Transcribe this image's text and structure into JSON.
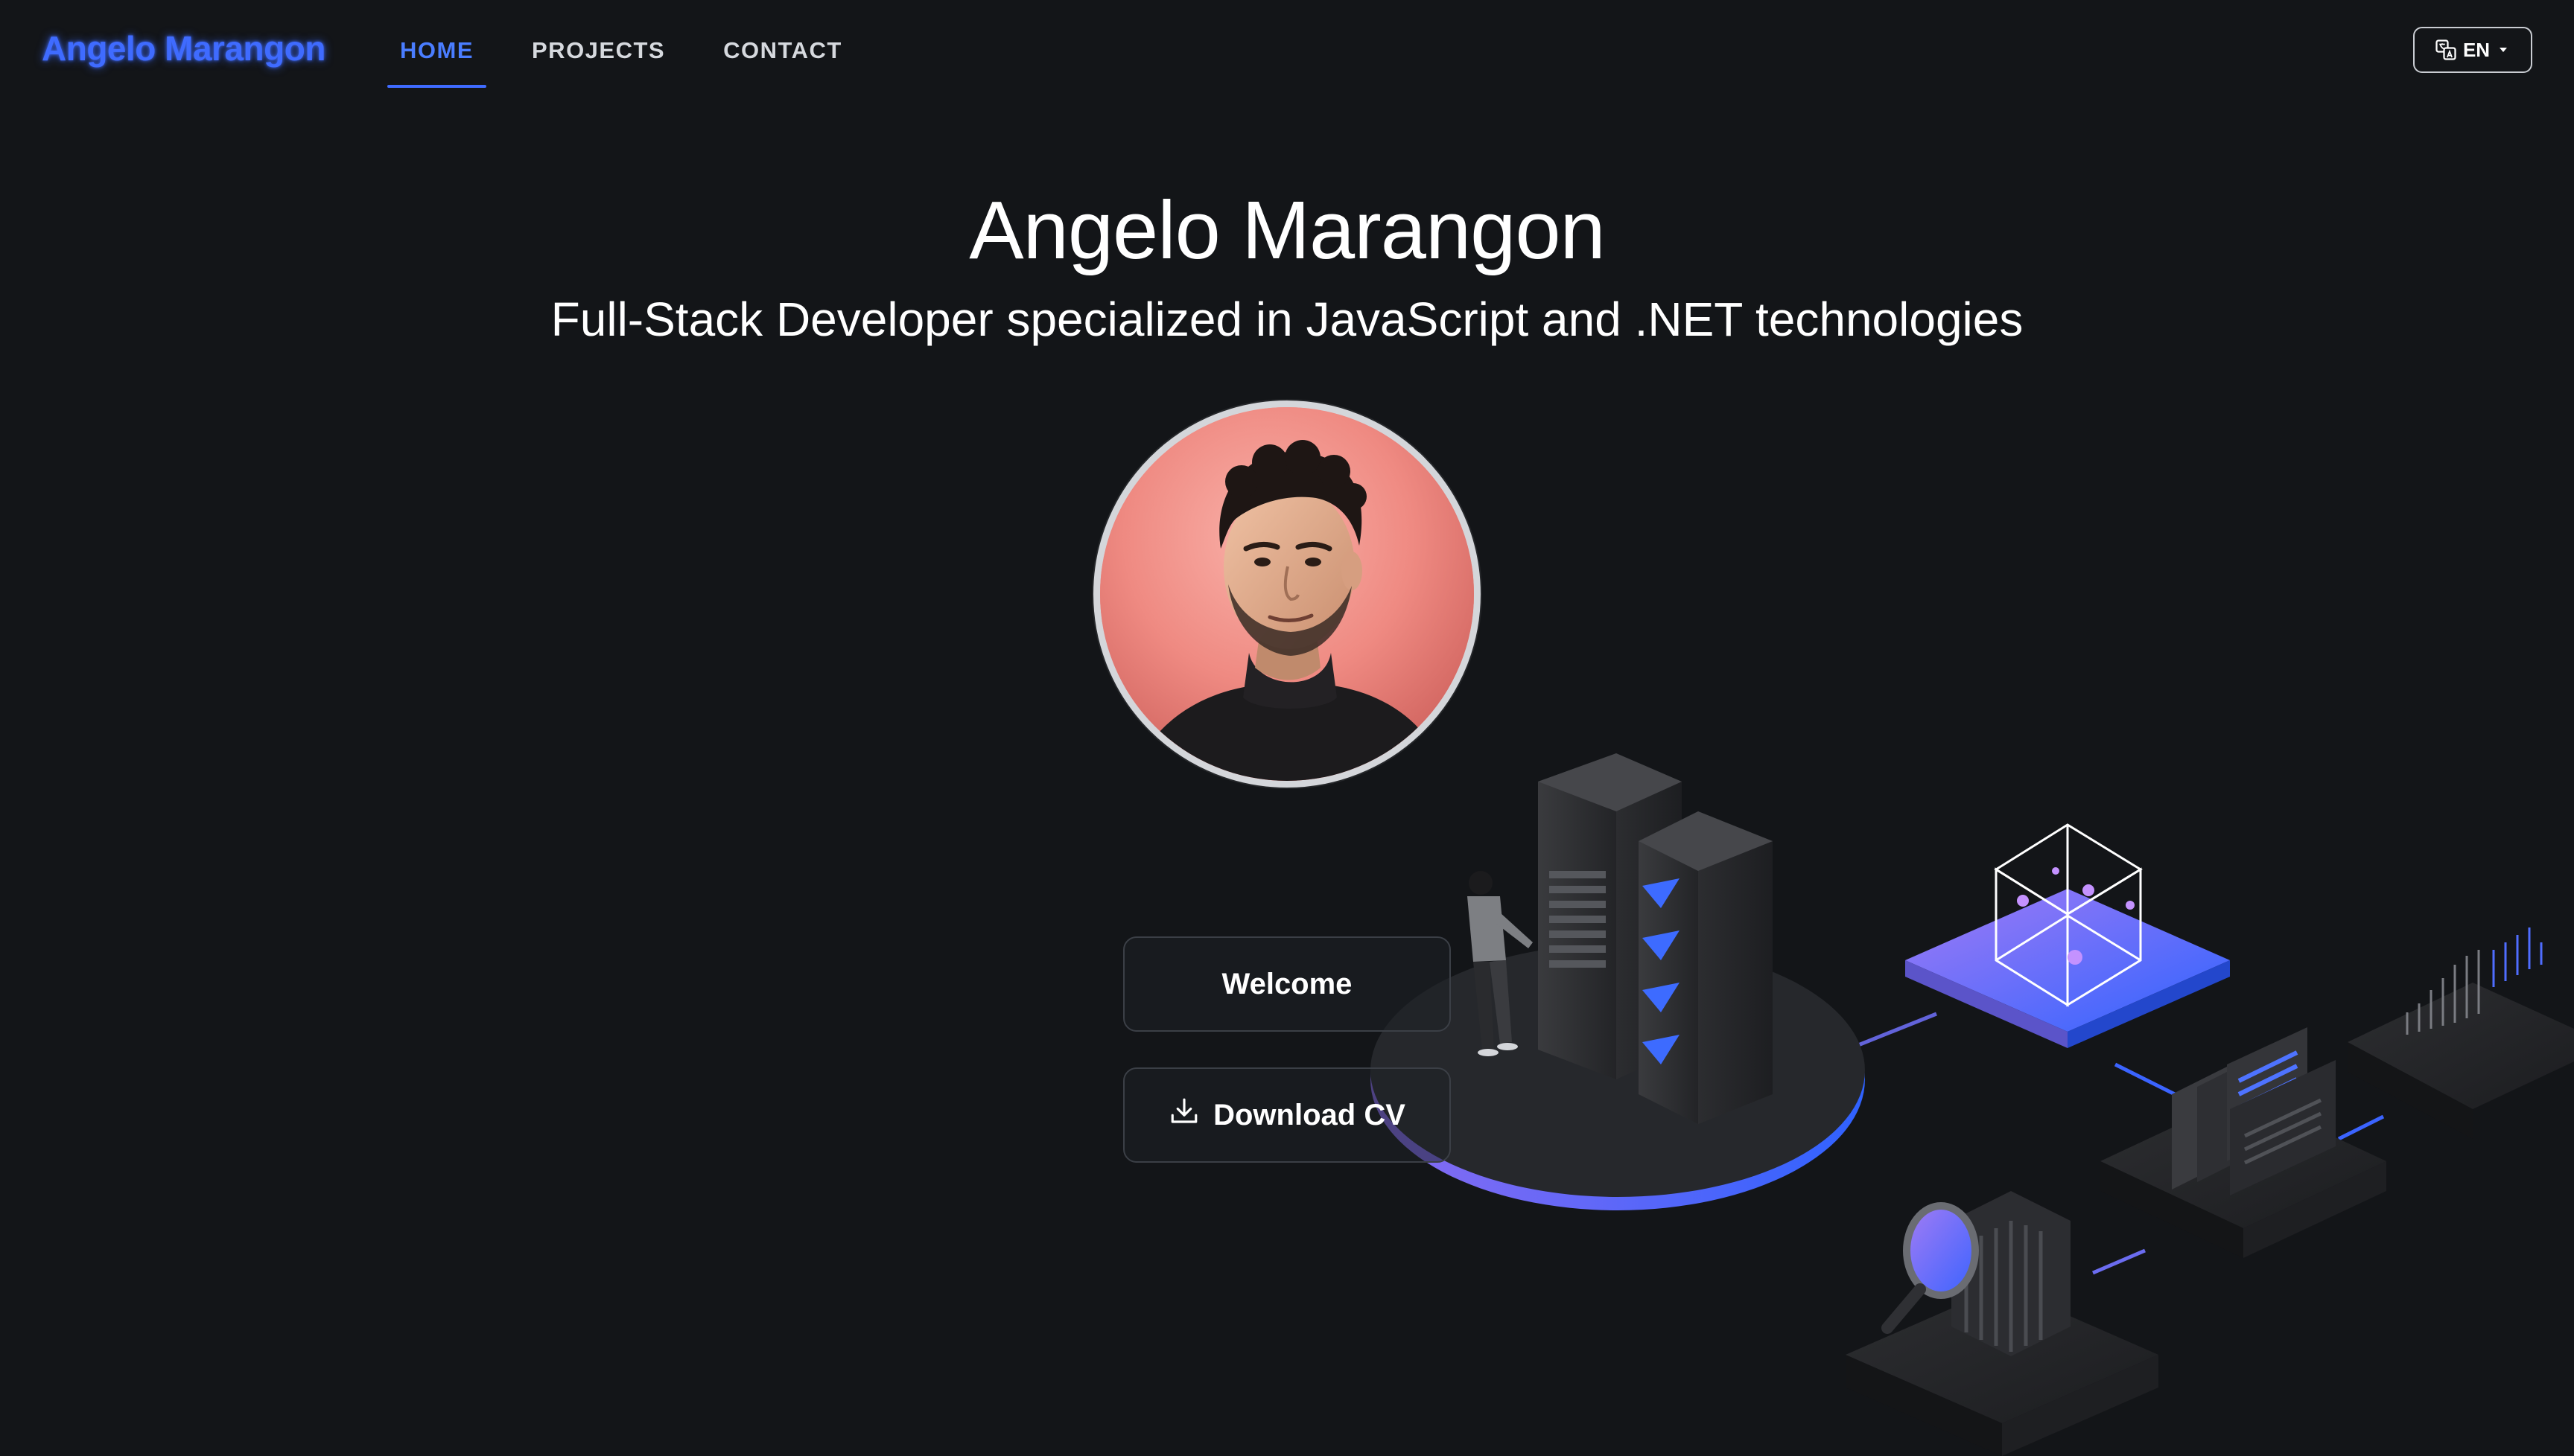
{
  "colors": {
    "background": "#141619",
    "accent": "#3f6bff",
    "text": "#ffffff",
    "nav_text": "#d6d9de"
  },
  "navbar": {
    "brand": "Angelo Marangon",
    "links": [
      {
        "label": "HOME",
        "active": true
      },
      {
        "label": "PROJECTS",
        "active": false
      },
      {
        "label": "CONTACT",
        "active": false
      }
    ],
    "language": {
      "label": "EN",
      "icon": "translate-icon",
      "caret_icon": "caret-down-icon"
    }
  },
  "hero": {
    "title": "Angelo Marangon",
    "subtitle": "Full-Stack Developer specialized in JavaScript and .NET technologies",
    "avatar_alt": "profile-photo"
  },
  "actions": {
    "welcome_label": "Welcome",
    "download_label": "Download CV",
    "download_icon": "download-icon"
  }
}
